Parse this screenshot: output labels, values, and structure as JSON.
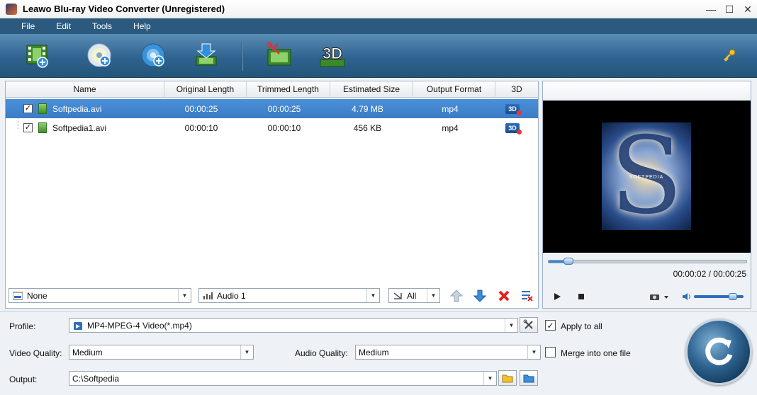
{
  "window": {
    "title": "Leawo Blu-ray Video Converter (Unregistered)",
    "minimize": "—",
    "maximize": "☐",
    "close": "✕"
  },
  "menu": [
    "File",
    "Edit",
    "Tools",
    "Help"
  ],
  "toolbar": {
    "icons": [
      "add-video-icon",
      "add-bluray-icon",
      "add-dvd-icon",
      "download-icon",
      "trim-icon",
      "3d-icon",
      "key-icon"
    ],
    "threed_label": "3D"
  },
  "table": {
    "columns": [
      "Name",
      "Original Length",
      "Trimmed Length",
      "Estimated Size",
      "Output Format",
      "3D"
    ],
    "rows": [
      {
        "checked": true,
        "name": "Softpedia.avi",
        "original_length": "00:00:25",
        "trimmed_length": "00:00:25",
        "estimated_size": "4.79 MB",
        "output_format": "mp4",
        "threed": "3D"
      },
      {
        "checked": true,
        "name": "Softpedia1.avi",
        "original_length": "00:00:10",
        "trimmed_length": "00:00:10",
        "estimated_size": "456 KB",
        "output_format": "mp4",
        "threed": "3D"
      }
    ]
  },
  "subtitle_select": "None",
  "audio_select": "Audio 1",
  "filter_select": "All",
  "preview": {
    "poster_caption": "SOFTPEDIA",
    "progress": 0.08,
    "volume": 0.85,
    "time": "00:00:02 / 00:00:25"
  },
  "settings": {
    "profile_label": "Profile:",
    "profile_value": "MP4-MPEG-4 Video(*.mp4)",
    "apply_to_all": "Apply to all",
    "apply_to_all_checked": true,
    "video_quality_label": "Video Quality:",
    "video_quality_value": "Medium",
    "audio_quality_label": "Audio Quality:",
    "audio_quality_value": "Medium",
    "merge_label": "Merge into one file",
    "merge_checked": false,
    "output_label": "Output:",
    "output_value": "C:\\Softpedia"
  },
  "colors": {
    "menubar": "#2c5a7e",
    "selection": "#3a7cc6",
    "accent": "#2f6ebc"
  }
}
